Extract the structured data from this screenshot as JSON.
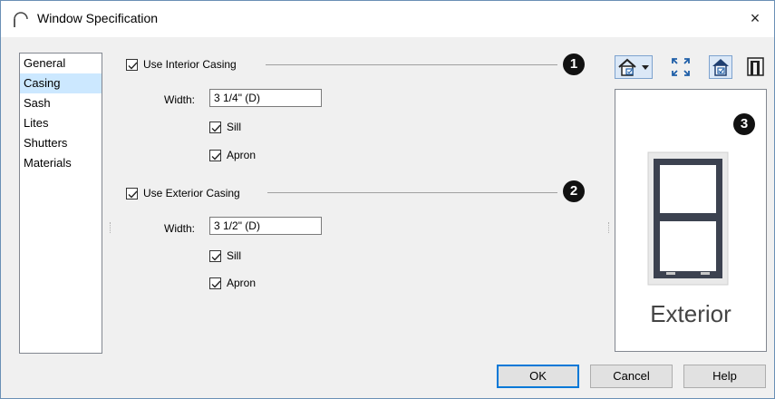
{
  "window": {
    "title": "Window Specification",
    "close_glyph": "×"
  },
  "nav": {
    "items": [
      {
        "label": "General",
        "selected": false
      },
      {
        "label": "Casing",
        "selected": true
      },
      {
        "label": "Sash",
        "selected": false
      },
      {
        "label": "Lites",
        "selected": false
      },
      {
        "label": "Shutters",
        "selected": false
      },
      {
        "label": "Materials",
        "selected": false
      }
    ]
  },
  "interior": {
    "use_label": "Use Interior Casing",
    "use_checked": true,
    "width_label": "Width:",
    "width_value": "3 1/4\" (D)",
    "sill_label": "Sill",
    "sill_checked": true,
    "apron_label": "Apron",
    "apron_checked": true,
    "badge": "1"
  },
  "exterior": {
    "use_label": "Use Exterior Casing",
    "use_checked": true,
    "width_label": "Width:",
    "width_value": "3 1/2\" (D)",
    "sill_label": "Sill",
    "sill_checked": true,
    "apron_label": "Apron",
    "apron_checked": true,
    "badge": "2"
  },
  "preview": {
    "badge": "3",
    "label": "Exterior"
  },
  "toolbar": {
    "icons": [
      "house-view-dropdown-icon",
      "fill-window-icon",
      "exterior-view-icon",
      "casing-icon"
    ]
  },
  "buttons": {
    "ok": "OK",
    "cancel": "Cancel",
    "help": "Help"
  },
  "colors": {
    "accent": "#0078d7",
    "selection": "#cce8ff",
    "window_frame": "#3c4250"
  }
}
